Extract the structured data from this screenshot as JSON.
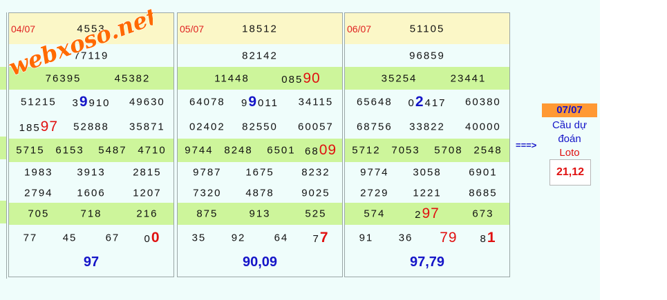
{
  "watermark": "webxoso.net",
  "panels": [
    {
      "date": "04/07",
      "rows": [
        [
          "4553"
        ],
        [
          "77119"
        ],
        [
          "76395",
          "45382"
        ],
        [
          "51215",
          [
            "3",
            "9",
            "910"
          ],
          "49630"
        ],
        [
          [
            "185",
            "97",
            ""
          ],
          "52888",
          "35871"
        ],
        [
          "5715",
          "6153",
          "5487",
          "4710"
        ],
        [
          "1983",
          "3913",
          "2815"
        ],
        [
          "2794",
          "1606",
          "1207"
        ],
        [
          "705",
          "718",
          "216"
        ],
        [
          "77",
          "45",
          "67",
          [
            "0",
            "0",
            ""
          ]
        ]
      ],
      "result": "97"
    },
    {
      "date": "05/07",
      "rows": [
        [
          "18512"
        ],
        [
          "82142"
        ],
        [
          "11448",
          [
            "085",
            "90",
            ""
          ]
        ],
        [
          "64078",
          [
            "9",
            "9",
            "011"
          ],
          "34115"
        ],
        [
          "02402",
          "82550",
          "60057"
        ],
        [
          "9744",
          "8248",
          "6501",
          [
            "68",
            "09",
            ""
          ]
        ],
        [
          "9787",
          "1675",
          "8232"
        ],
        [
          "7320",
          "4878",
          "9025"
        ],
        [
          "875",
          "913",
          "525"
        ],
        [
          "35",
          "92",
          "64",
          [
            "7",
            "7",
            ""
          ]
        ]
      ],
      "result": "90,09"
    },
    {
      "date": "06/07",
      "rows": [
        [
          "51105"
        ],
        [
          "96859"
        ],
        [
          "35254",
          "23441"
        ],
        [
          "65648",
          [
            "0",
            "2",
            "417"
          ],
          "60380"
        ],
        [
          "68756",
          "33822",
          "40000"
        ],
        [
          "5712",
          "7053",
          "5708",
          "2548"
        ],
        [
          "9774",
          "3058",
          "6901"
        ],
        [
          "2729",
          "1221",
          "8685"
        ],
        [
          "574",
          [
            "2",
            "97",
            ""
          ],
          "673"
        ],
        [
          "91",
          "36",
          [
            "",
            "79",
            ""
          ],
          [
            "8",
            "1",
            ""
          ]
        ]
      ],
      "result": "97,79"
    }
  ],
  "prediction": {
    "arrow": "===>",
    "date": "07/07",
    "label_line1": "Cầu dự",
    "label_line2": "đoán",
    "label_line3": "Loto",
    "value": "21,12"
  },
  "colors": {
    "background": "#effdfb",
    "header_row": "#fbf7c7",
    "green_row": "#cdf59b",
    "highlight_red": "#e01010",
    "highlight_blue": "#1414c8",
    "prediction_date_bg": "#ff9933",
    "watermark": "#ff6a00"
  }
}
